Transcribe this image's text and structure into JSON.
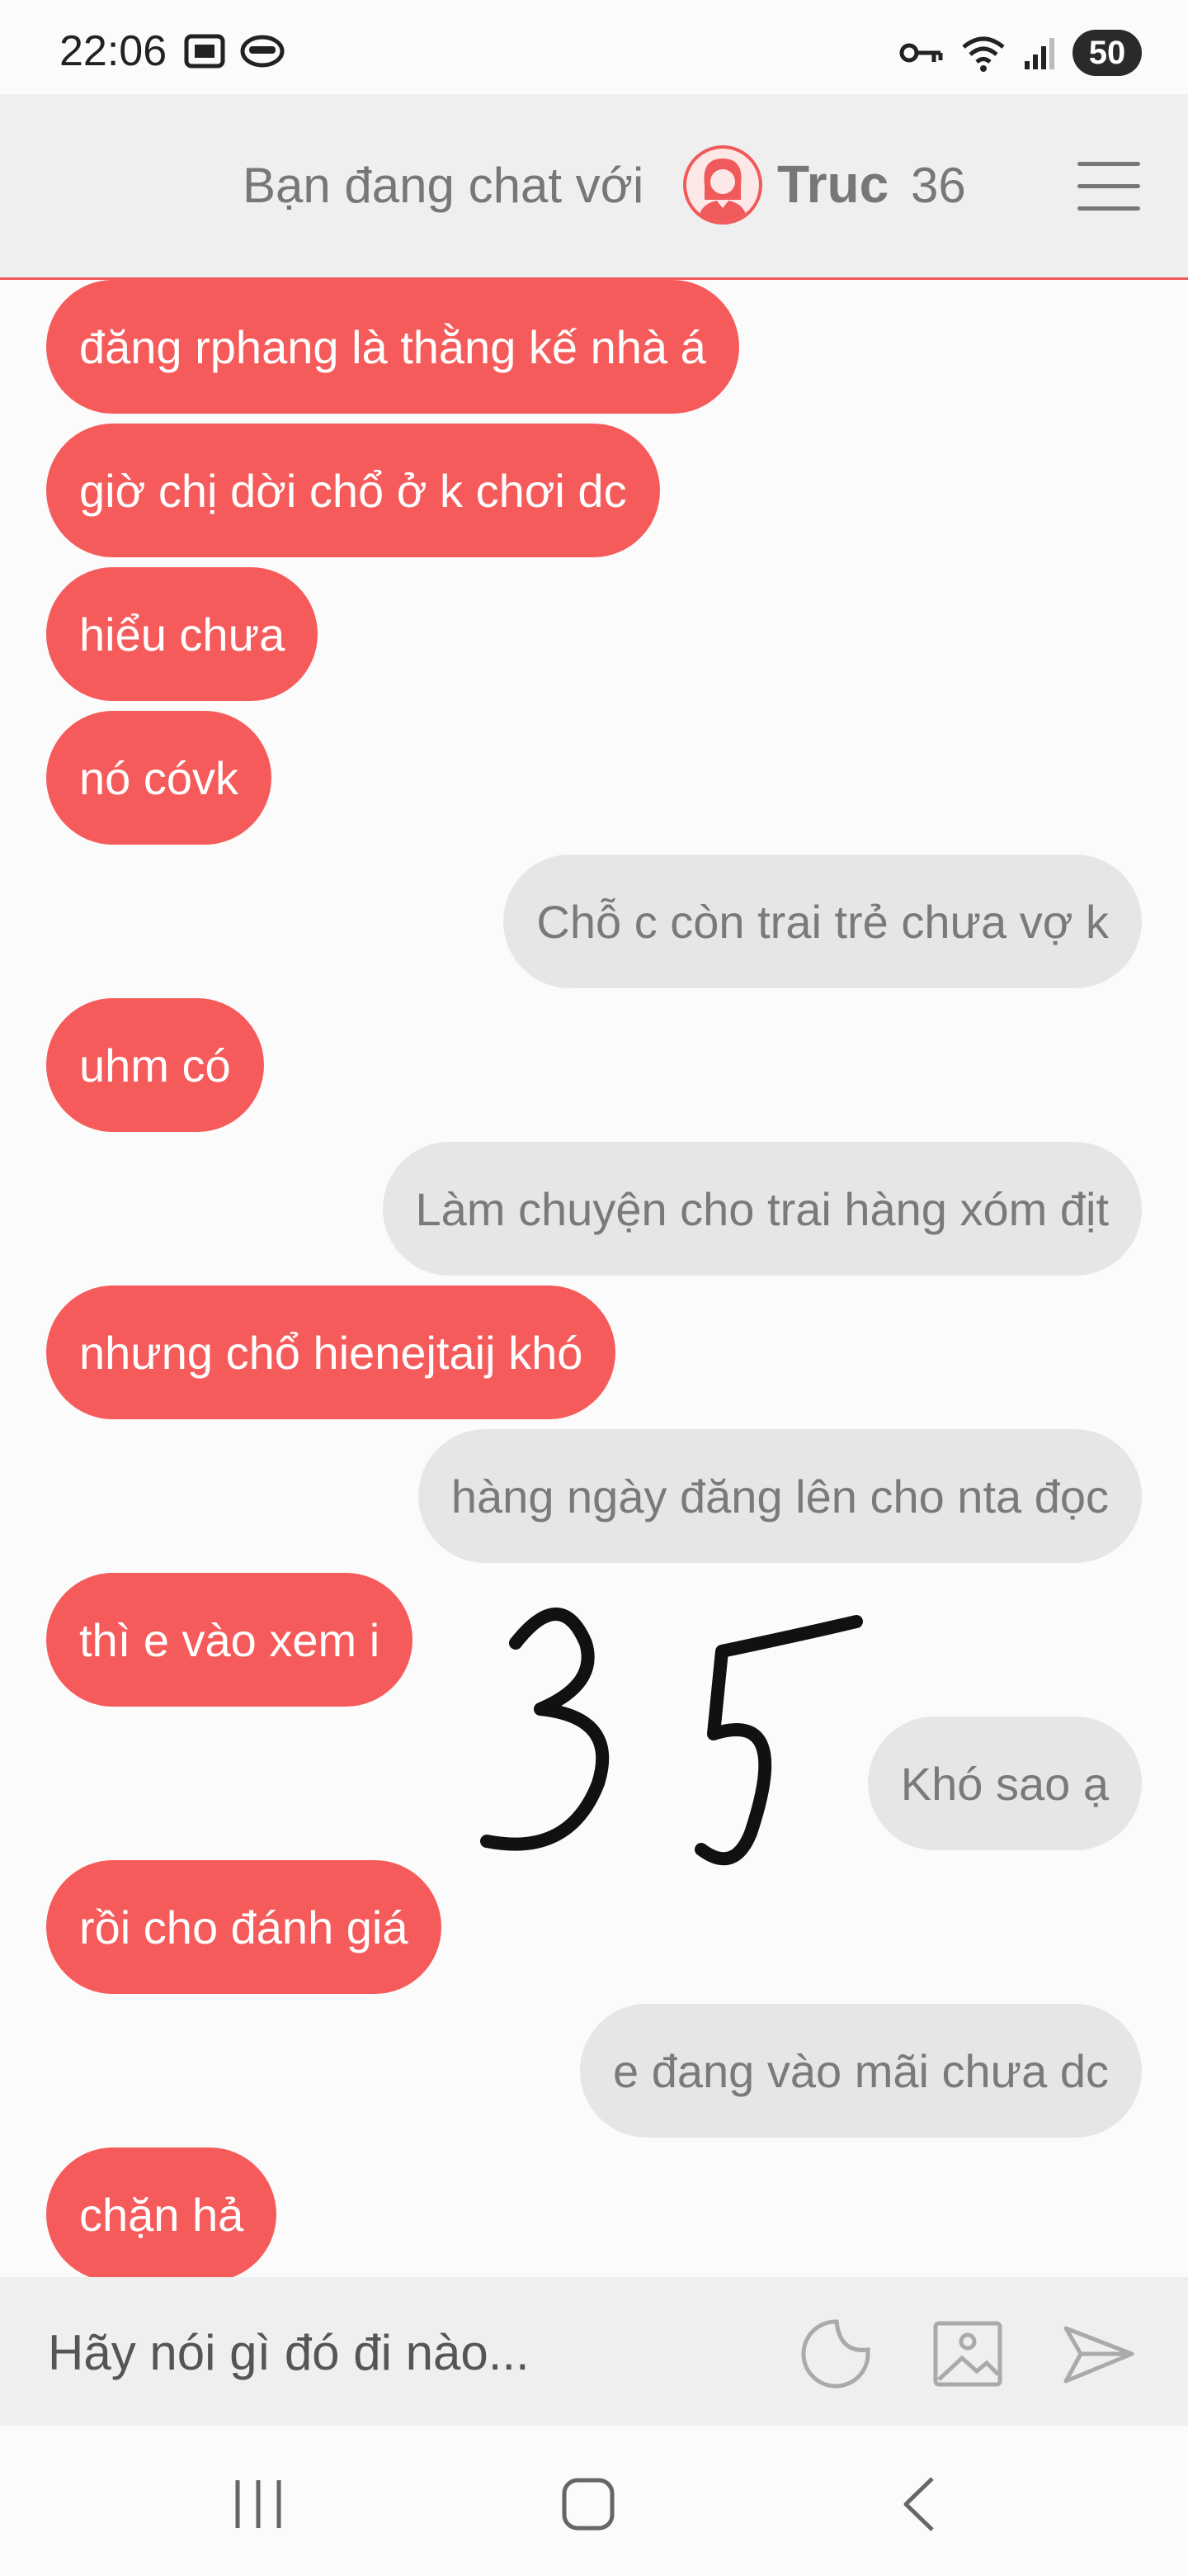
{
  "status_bar": {
    "time": "22:06",
    "battery": "50",
    "icons": [
      "screenshot-icon",
      "chat-app-icon",
      "vpn-key-icon",
      "wifi-icon",
      "signal-icon"
    ]
  },
  "header": {
    "prefix": "Bạn đang chat với",
    "name": "Truc",
    "count": "36",
    "accent_color": "#f05a5a"
  },
  "messages": [
    {
      "side": "in",
      "text": "đăng rphang là thằng kế nhà á"
    },
    {
      "side": "in",
      "text": "giờ chị dời chổ ở k chơi dc"
    },
    {
      "side": "in",
      "text": "hiểu chưa"
    },
    {
      "side": "in",
      "text": "nó cóvk"
    },
    {
      "side": "out",
      "text": "Chỗ c còn trai trẻ chưa vợ k"
    },
    {
      "side": "in",
      "text": "uhm có"
    },
    {
      "side": "out",
      "text": "Làm chuyện cho trai hàng xóm địt"
    },
    {
      "side": "in",
      "text": "nhưng chổ hienejtaij khó"
    },
    {
      "side": "out",
      "text": "hàng ngày đăng lên cho nta đọc"
    },
    {
      "side": "in",
      "text": "thì e vào xem i"
    },
    {
      "side": "out",
      "text": "Khó sao ạ"
    },
    {
      "side": "in",
      "text": "rồi cho đánh giá"
    },
    {
      "side": "out",
      "text": "e đang vào mãi chưa dc"
    },
    {
      "side": "in",
      "text": "chặn hả"
    }
  ],
  "colors": {
    "incoming_bubble": "#f65b5b",
    "outgoing_bubble": "#e6e6e6"
  },
  "input_bar": {
    "placeholder": "Hãy nói gì đó đi nào...",
    "icons": [
      "sticker-icon",
      "image-icon",
      "send-icon"
    ]
  },
  "nav_bar": {
    "buttons": [
      "recent-apps-icon",
      "home-icon",
      "back-icon"
    ]
  }
}
